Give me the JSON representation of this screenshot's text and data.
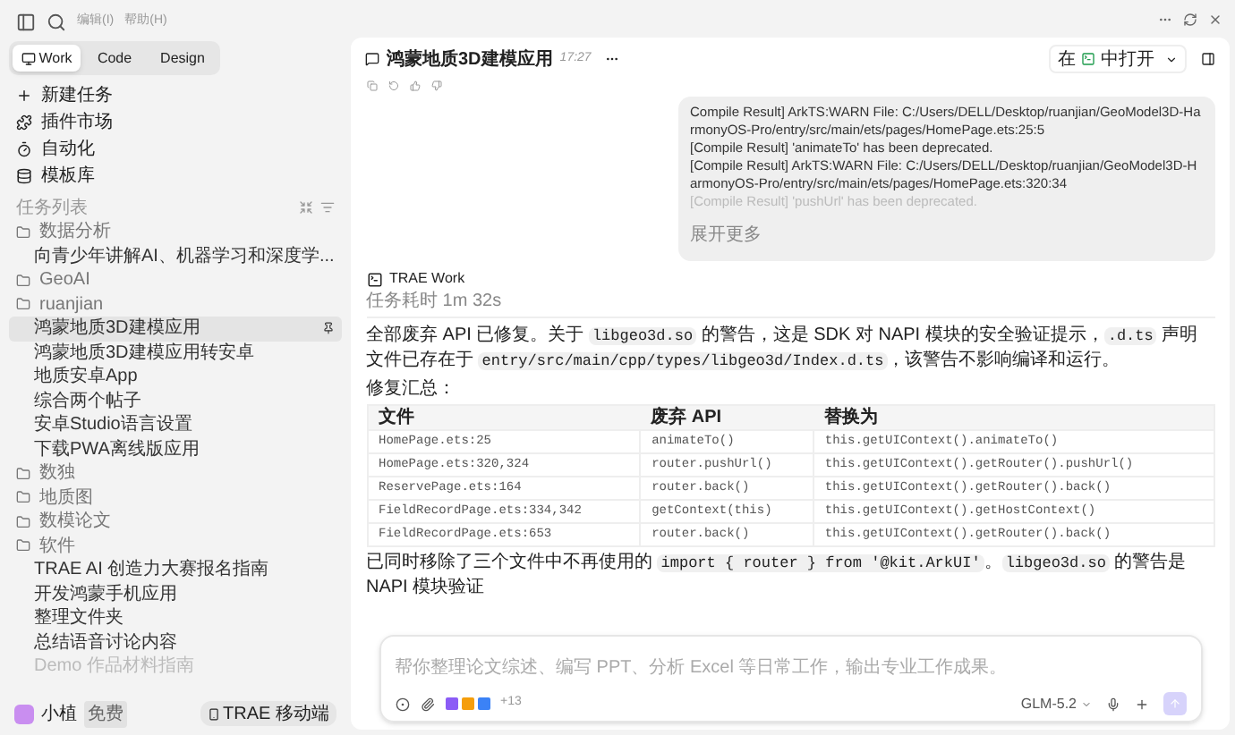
{
  "menu": [
    "编辑(I)",
    "帮助(H)"
  ],
  "mode_tabs": [
    {
      "label": "Work",
      "selected": true
    },
    {
      "label": "Code",
      "selected": false
    },
    {
      "label": "Design",
      "selected": false
    }
  ],
  "nav": [
    {
      "label": "新建任务",
      "kind": "new"
    },
    {
      "label": "插件市场",
      "kind": "plugins"
    },
    {
      "label": "自动化",
      "kind": "auto"
    },
    {
      "label": "模板库",
      "kind": "templates"
    }
  ],
  "task_list": {
    "title": "任务列表",
    "groups": [
      {
        "label": "数据分析",
        "children": [
          {
            "label": "向青少年讲解AI、机器学习和深度学...",
            "selected": false
          }
        ]
      },
      {
        "label": "GeoAI"
      },
      {
        "label": "ruanjian",
        "children": [
          {
            "label": "鸿蒙地质3D建模应用",
            "selected": true
          },
          {
            "label": "鸿蒙地质3D建模应用转安卓",
            "selected": false
          },
          {
            "label": "地质安卓App",
            "selected": false
          },
          {
            "label": "综合两个帖子",
            "selected": false
          },
          {
            "label": "安卓Studio语言设置",
            "selected": false
          },
          {
            "label": "下载PWA离线版应用",
            "selected": false
          }
        ]
      },
      {
        "label": "数独"
      },
      {
        "label": "地质图"
      },
      {
        "label": "数模论文"
      },
      {
        "label": "软件",
        "children": [
          {
            "label": "TRAE AI 创造力大赛报名指南",
            "selected": false
          },
          {
            "label": "开发鸿蒙手机应用",
            "selected": false
          },
          {
            "label": "整理文件夹",
            "selected": false
          },
          {
            "label": "总结语音讨论内容",
            "selected": false
          },
          {
            "label": "Demo 作品材料指南",
            "selected": false
          }
        ]
      }
    ]
  },
  "user": {
    "name": "小植",
    "plan": "免费",
    "mobile_button": "TRAE 移动端"
  },
  "chat_header": {
    "title": "鸿蒙地质3D建模应用",
    "time": "17:27",
    "open_prefix": "在",
    "open_suffix": "中打开"
  },
  "user_message": {
    "lines": [
      "Compile Result] ArkTS:WARN File: C:/Users/DELL/Desktop/ruanjian/GeoModel3D-HarmonyOS-Pro/entry/src/main/ets/pages/HomePage.ets:25:5",
      "[Compile Result]  'animateTo' has been deprecated.",
      "[Compile Result] ArkTS:WARN File: C:/Users/DELL/Desktop/ruanjian/GeoModel3D-HarmonyOS-Pro/entry/src/main/ets/pages/HomePage.ets:320:34",
      "[Compile Result]  'pushUrl' has been deprecated."
    ],
    "expand": "展开更多"
  },
  "reply": {
    "agent": "TRAE Work",
    "duration": "任务耗时 1m 32s",
    "paragraph": [
      {
        "kind": "text",
        "text": "全部废弃 API 已修复。关于 "
      },
      {
        "kind": "code",
        "text": "libgeo3d.so"
      },
      {
        "kind": "text",
        "text": " 的警告，这是 SDK 对 NAPI 模块的安全验证提示，"
      },
      {
        "kind": "code",
        "text": ".d.ts"
      },
      {
        "kind": "text",
        "text": " 声明文件已存在于 "
      },
      {
        "kind": "code",
        "text": "entry/src/main/cpp/types/libgeo3d/Index.d.ts"
      },
      {
        "kind": "text",
        "text": "，该警告不影响编译和运行。"
      }
    ],
    "summary_title": "修复汇总：",
    "table": {
      "columns": [
        "文件",
        "废弃 API",
        "替换为"
      ],
      "rows": [
        [
          "HomePage.ets:25",
          "animateTo()",
          "this.getUIContext().animateTo()"
        ],
        [
          "HomePage.ets:320,324",
          "router.pushUrl()",
          "this.getUIContext().getRouter().pushUrl()"
        ],
        [
          "ReservePage.ets:164",
          "router.back()",
          "this.getUIContext().getRouter().back()"
        ],
        [
          "FieldRecordPage.ets:334,342",
          "getContext(this)",
          "this.getUIContext().getHostContext()"
        ],
        [
          "FieldRecordPage.ets:653",
          "router.back()",
          "this.getUIContext().getRouter().back()"
        ]
      ]
    },
    "last_line": [
      {
        "kind": "text",
        "text": "已同时移除了三个文件中不再使用的 "
      },
      {
        "kind": "code",
        "text": "import { router } from '@kit.ArkUI'"
      },
      {
        "kind": "text",
        "text": "。"
      },
      {
        "kind": "code",
        "text": "libgeo3d.so"
      },
      {
        "kind": "text",
        "text": " 的警告是 NAPI 模块验证"
      }
    ]
  },
  "composer": {
    "placeholder": "帮你整理论文综述、编写 PPT、分析 Excel 等日常工作，输出专业工作成果。",
    "extra_count": "+13",
    "model": "GLM-5.2"
  }
}
